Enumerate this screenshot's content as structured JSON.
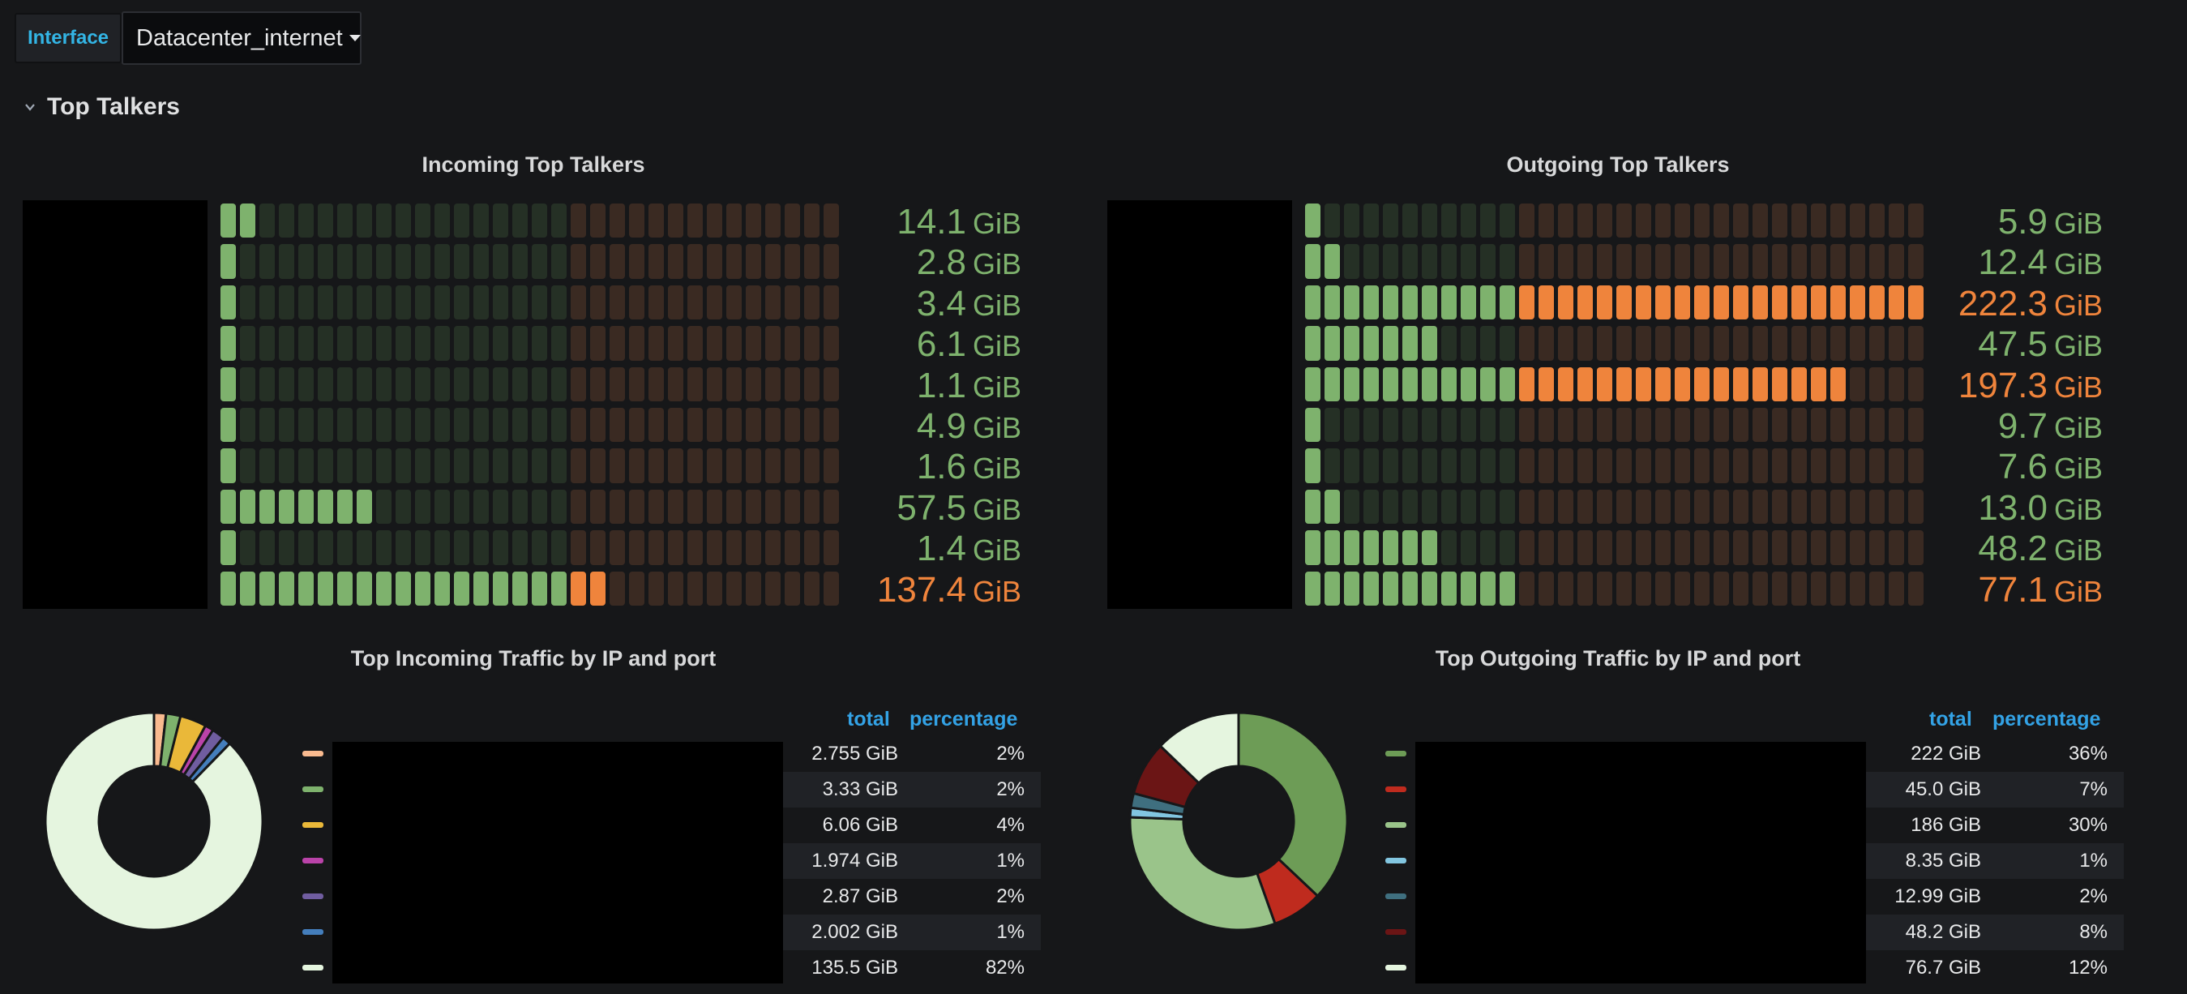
{
  "header": {
    "variable_label": "Interface",
    "variable_value": "Datacenter_internet",
    "row_title": "Top Talkers"
  },
  "colors": {
    "green": "#7eb26d",
    "orange": "#ef843c",
    "accent_blue": "#33a2e5"
  },
  "incoming_talkers": {
    "title": "Incoming Top Talkers",
    "max": 222.3,
    "threshold": 125,
    "rows": [
      {
        "value": "14.1",
        "unit": "GiB",
        "num": 14.1
      },
      {
        "value": "2.8",
        "unit": "GiB",
        "num": 2.8
      },
      {
        "value": "3.4",
        "unit": "GiB",
        "num": 3.4
      },
      {
        "value": "6.1",
        "unit": "GiB",
        "num": 6.1
      },
      {
        "value": "1.1",
        "unit": "GiB",
        "num": 1.1
      },
      {
        "value": "4.9",
        "unit": "GiB",
        "num": 4.9
      },
      {
        "value": "1.6",
        "unit": "GiB",
        "num": 1.6
      },
      {
        "value": "57.5",
        "unit": "GiB",
        "num": 57.5
      },
      {
        "value": "1.4",
        "unit": "GiB",
        "num": 1.4
      },
      {
        "value": "137.4",
        "unit": "GiB",
        "num": 137.4
      }
    ]
  },
  "outgoing_talkers": {
    "title": "Outgoing Top Talkers",
    "max": 222.3,
    "threshold": 75,
    "rows": [
      {
        "value": "5.9",
        "unit": "GiB",
        "num": 5.9
      },
      {
        "value": "12.4",
        "unit": "GiB",
        "num": 12.4
      },
      {
        "value": "222.3",
        "unit": "GiB",
        "num": 222.3
      },
      {
        "value": "47.5",
        "unit": "GiB",
        "num": 47.5
      },
      {
        "value": "197.3",
        "unit": "GiB",
        "num": 197.3
      },
      {
        "value": "9.7",
        "unit": "GiB",
        "num": 9.7
      },
      {
        "value": "7.6",
        "unit": "GiB",
        "num": 7.6
      },
      {
        "value": "13.0",
        "unit": "GiB",
        "num": 13.0
      },
      {
        "value": "48.2",
        "unit": "GiB",
        "num": 48.2
      },
      {
        "value": "77.1",
        "unit": "GiB",
        "num": 77.1
      }
    ]
  },
  "incoming_pie": {
    "title": "Top Incoming Traffic by IP and port",
    "col_total": "total",
    "col_percentage": "percentage",
    "rows": [
      {
        "color": "#f9ba8f",
        "total": "2.755 GiB",
        "percentage": "2%",
        "num": 2.755
      },
      {
        "color": "#7eb26d",
        "total": "3.33 GiB",
        "percentage": "2%",
        "num": 3.33
      },
      {
        "color": "#eab839",
        "total": "6.06 GiB",
        "percentage": "4%",
        "num": 6.06
      },
      {
        "color": "#ba43a9",
        "total": "1.974 GiB",
        "percentage": "1%",
        "num": 1.974
      },
      {
        "color": "#705da0",
        "total": "2.87 GiB",
        "percentage": "2%",
        "num": 2.87
      },
      {
        "color": "#447ebc",
        "total": "2.002 GiB",
        "percentage": "1%",
        "num": 2.002
      },
      {
        "color": "#e5f5df",
        "total": "135.5 GiB",
        "percentage": "82%",
        "num": 135.5
      }
    ]
  },
  "outgoing_pie": {
    "title": "Top Outgoing Traffic by IP and port",
    "col_total": "total",
    "col_percentage": "percentage",
    "rows": [
      {
        "color": "#6d9c56",
        "total": "222 GiB",
        "percentage": "36%",
        "num": 222
      },
      {
        "color": "#bf2b1e",
        "total": "45.0 GiB",
        "percentage": "7%",
        "num": 45.0
      },
      {
        "color": "#9ac48a",
        "total": "186 GiB",
        "percentage": "30%",
        "num": 186
      },
      {
        "color": "#82c6e0",
        "total": "8.35 GiB",
        "percentage": "1%",
        "num": 8.35
      },
      {
        "color": "#3f6f7f",
        "total": "12.99 GiB",
        "percentage": "2%",
        "num": 12.99
      },
      {
        "color": "#6b1515",
        "total": "48.2 GiB",
        "percentage": "8%",
        "num": 48.2
      },
      {
        "color": "#e5f5df",
        "total": "76.7 GiB",
        "percentage": "12%",
        "num": 76.7
      }
    ]
  }
}
